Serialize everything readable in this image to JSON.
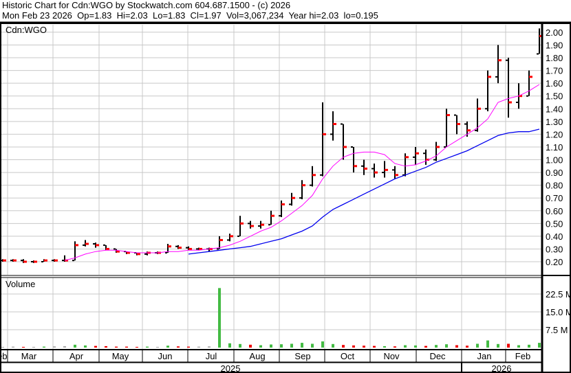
{
  "header": {
    "title": "Historic Chart for Cdn:WGO by Stockwatch.com 604.687.1500 - (c) 2026",
    "quote": "Mon Feb 23 2026  Op=1.83  Hi=2.03  Lo=1.83  Cl=1.97  Vol=3,067,234  Year hi=2.03  lo=0.195"
  },
  "colors": {
    "up_volume": "#44bb44",
    "down_volume": "#ee0000",
    "flat_volume": "#aaaaaa",
    "close_tick": "#ff0000",
    "ma_short": "#ff00ff",
    "ma_long": "#0000ee",
    "grid": "#c8c8c8"
  },
  "chart_data": {
    "type": "ohlc",
    "symbol_label": "Cdn:WGO",
    "volume_label": "Volume",
    "price_ticks": [
      "0.20",
      "0.30",
      "0.40",
      "0.50",
      "0.60",
      "0.70",
      "0.80",
      "0.90",
      "1.00",
      "1.10",
      "1.20",
      "1.30",
      "1.40",
      "1.50",
      "1.60",
      "1.70",
      "1.80",
      "1.90",
      "2.00"
    ],
    "ylim": [
      0.15,
      2.06
    ],
    "volume_ticks": [
      "7.5 M",
      "15.0 M",
      "22.5 M"
    ],
    "volume_ylim": [
      0,
      29
    ],
    "months": [
      "eb",
      "Mar",
      "Apr",
      "May",
      "Jun",
      "Jul",
      "Aug",
      "Sep",
      "Oct",
      "Nov",
      "Dec",
      "Jan",
      "Feb"
    ],
    "years": [
      "2025",
      "2026"
    ],
    "grid": true,
    "dates": [
      "2025-02-24",
      "2025-03-03",
      "2025-03-10",
      "2025-03-17",
      "2025-03-24",
      "2025-03-31",
      "2025-04-07",
      "2025-04-14",
      "2025-04-21",
      "2025-04-28",
      "2025-05-05",
      "2025-05-12",
      "2025-05-19",
      "2025-05-26",
      "2025-06-02",
      "2025-06-09",
      "2025-06-16",
      "2025-06-23",
      "2025-06-30",
      "2025-07-07",
      "2025-07-14",
      "2025-07-21",
      "2025-07-28",
      "2025-08-04",
      "2025-08-11",
      "2025-08-18",
      "2025-08-25",
      "2025-09-01",
      "2025-09-08",
      "2025-09-15",
      "2025-09-22",
      "2025-09-29",
      "2025-10-06",
      "2025-10-13",
      "2025-10-20",
      "2025-10-27",
      "2025-11-03",
      "2025-11-10",
      "2025-11-17",
      "2025-11-24",
      "2025-12-01",
      "2025-12-08",
      "2025-12-15",
      "2025-12-22",
      "2025-12-29",
      "2026-01-05",
      "2026-01-12",
      "2026-01-19",
      "2026-01-26",
      "2026-02-02",
      "2026-02-09",
      "2026-02-16",
      "2026-02-23"
    ],
    "open": [
      0.21,
      0.21,
      0.21,
      0.2,
      0.2,
      0.21,
      0.21,
      0.21,
      0.33,
      0.34,
      0.33,
      0.3,
      0.28,
      0.27,
      0.26,
      0.27,
      0.27,
      0.32,
      0.31,
      0.3,
      0.3,
      0.3,
      0.37,
      0.4,
      0.5,
      0.48,
      0.49,
      0.56,
      0.65,
      0.7,
      0.8,
      0.88,
      1.2,
      1.28,
      1.1,
      0.95,
      0.93,
      0.9,
      0.92,
      0.88,
      1.02,
      1.05,
      1.0,
      1.1,
      1.35,
      1.28,
      1.23,
      1.4,
      1.65,
      1.78,
      1.45,
      1.5,
      1.83
    ],
    "high": [
      0.22,
      0.22,
      0.22,
      0.21,
      0.22,
      0.22,
      0.25,
      0.36,
      0.37,
      0.35,
      0.33,
      0.3,
      0.28,
      0.27,
      0.28,
      0.28,
      0.34,
      0.33,
      0.32,
      0.31,
      0.31,
      0.4,
      0.42,
      0.56,
      0.52,
      0.52,
      0.6,
      0.68,
      0.74,
      0.84,
      0.95,
      1.45,
      1.38,
      1.28,
      1.1,
      1.0,
      0.97,
      0.99,
      0.95,
      1.05,
      1.1,
      1.08,
      1.14,
      1.4,
      1.35,
      1.3,
      1.48,
      1.7,
      1.9,
      1.8,
      1.6,
      1.7,
      2.03
    ],
    "low": [
      0.2,
      0.2,
      0.19,
      0.19,
      0.2,
      0.2,
      0.2,
      0.21,
      0.32,
      0.31,
      0.29,
      0.27,
      0.26,
      0.25,
      0.25,
      0.26,
      0.27,
      0.3,
      0.29,
      0.29,
      0.28,
      0.3,
      0.36,
      0.4,
      0.46,
      0.46,
      0.49,
      0.55,
      0.64,
      0.69,
      0.79,
      0.87,
      1.15,
      1.0,
      0.9,
      0.88,
      0.86,
      0.86,
      0.85,
      0.87,
      0.96,
      0.96,
      0.99,
      1.1,
      1.2,
      1.18,
      1.22,
      1.38,
      1.6,
      1.33,
      1.4,
      1.5,
      1.83
    ],
    "close": [
      0.21,
      0.21,
      0.2,
      0.2,
      0.21,
      0.21,
      0.21,
      0.33,
      0.34,
      0.33,
      0.3,
      0.28,
      0.27,
      0.26,
      0.27,
      0.27,
      0.32,
      0.31,
      0.3,
      0.3,
      0.3,
      0.37,
      0.4,
      0.5,
      0.48,
      0.49,
      0.56,
      0.65,
      0.7,
      0.8,
      0.88,
      1.2,
      1.28,
      1.1,
      0.95,
      0.93,
      0.9,
      0.92,
      0.88,
      1.02,
      1.05,
      1.0,
      1.1,
      1.35,
      1.28,
      1.23,
      1.4,
      1.65,
      1.78,
      1.45,
      1.5,
      1.65,
      1.97
    ],
    "volume_m": [
      0.3,
      0.4,
      0.3,
      0.3,
      0.4,
      0.5,
      0.6,
      1.2,
      0.9,
      0.7,
      0.6,
      0.4,
      0.4,
      0.3,
      0.4,
      0.3,
      0.8,
      0.5,
      0.4,
      0.4,
      0.5,
      25.0,
      1.8,
      1.5,
      1.2,
      1.0,
      1.3,
      1.4,
      1.6,
      2.0,
      1.6,
      2.6,
      1.5,
      1.1,
      0.9,
      0.8,
      0.7,
      0.6,
      0.5,
      1.0,
      0.9,
      0.7,
      1.1,
      1.4,
      1.0,
      0.8,
      1.6,
      3.0,
      1.5,
      1.6,
      1.0,
      1.2,
      2.0
    ],
    "ma_short": [
      null,
      null,
      null,
      null,
      null,
      null,
      0.21,
      0.23,
      0.26,
      0.28,
      0.29,
      0.29,
      0.28,
      0.27,
      0.27,
      0.27,
      0.28,
      0.28,
      0.29,
      0.29,
      0.3,
      0.31,
      0.33,
      0.36,
      0.4,
      0.44,
      0.47,
      0.52,
      0.58,
      0.64,
      0.72,
      0.85,
      0.95,
      1.02,
      1.05,
      1.06,
      1.06,
      1.04,
      0.97,
      0.95,
      0.96,
      0.99,
      1.03,
      1.1,
      1.15,
      1.2,
      1.25,
      1.32,
      1.45,
      1.48,
      1.5,
      1.54,
      1.59
    ],
    "ma_long": [
      null,
      null,
      null,
      null,
      null,
      null,
      null,
      null,
      null,
      null,
      null,
      null,
      null,
      null,
      null,
      null,
      null,
      null,
      0.26,
      0.27,
      0.28,
      0.29,
      0.3,
      0.31,
      0.32,
      0.34,
      0.36,
      0.38,
      0.41,
      0.44,
      0.48,
      0.55,
      0.61,
      0.65,
      0.69,
      0.73,
      0.77,
      0.81,
      0.85,
      0.88,
      0.91,
      0.94,
      0.98,
      1.01,
      1.04,
      1.07,
      1.11,
      1.15,
      1.19,
      1.21,
      1.22,
      1.22,
      1.24
    ]
  }
}
